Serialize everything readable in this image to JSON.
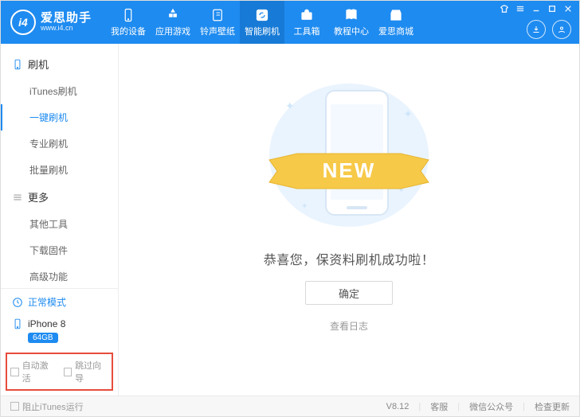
{
  "app": {
    "name": "爱思助手",
    "site": "www.i4.cn",
    "logo_text": "i4"
  },
  "titlebar_nav": [
    {
      "label": "我的设备",
      "icon": "phone"
    },
    {
      "label": "应用游戏",
      "icon": "apps"
    },
    {
      "label": "铃声壁纸",
      "icon": "music"
    },
    {
      "label": "智能刷机",
      "icon": "refresh",
      "active": true
    },
    {
      "label": "工具箱",
      "icon": "toolbox"
    },
    {
      "label": "教程中心",
      "icon": "book"
    },
    {
      "label": "爱思商城",
      "icon": "store"
    }
  ],
  "sidebar": {
    "groups": [
      {
        "title": "刷机",
        "icon": "phone",
        "items": [
          {
            "label": "iTunes刷机"
          },
          {
            "label": "一键刷机",
            "active": true
          },
          {
            "label": "专业刷机"
          },
          {
            "label": "批量刷机"
          }
        ]
      },
      {
        "title": "更多",
        "icon": "menu",
        "items": [
          {
            "label": "其他工具"
          },
          {
            "label": "下载固件"
          },
          {
            "label": "高级功能"
          }
        ]
      }
    ],
    "mode_label": "正常模式",
    "device_name": "iPhone 8",
    "device_badge": "64GB",
    "checks": {
      "auto_activate": "自动激活",
      "skip_wizard": "跳过向导"
    }
  },
  "main": {
    "ribbon_text": "NEW",
    "message": "恭喜您，保资料刷机成功啦！",
    "confirm_btn": "确定",
    "view_log": "查看日志"
  },
  "statusbar": {
    "block_itunes": "阻止iTunes运行",
    "version": "V8.12",
    "support": "客服",
    "wechat": "微信公众号",
    "update": "检查更新"
  }
}
